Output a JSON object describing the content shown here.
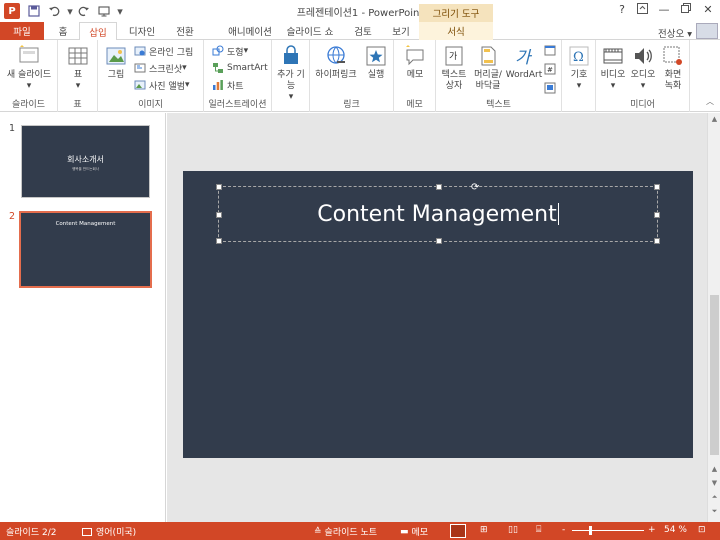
{
  "app": {
    "title": "프레젠테이션1 - PowerPoint",
    "context_tool": "그리기 도구",
    "user": "전상오",
    "logo": "P"
  },
  "icons": {
    "save": "floppy-icon",
    "undo": "undo-icon",
    "redo": "redo-icon",
    "start": "slideshow-icon",
    "help": "?",
    "minimize": "—",
    "restore": "▫",
    "close": "✕"
  },
  "tabs": {
    "file": "파일",
    "home": "홈",
    "insert": "삽입",
    "design": "디자인",
    "transitions": "전환",
    "animations": "애니메이션",
    "slideshow": "슬라이드 쇼",
    "review": "검토",
    "view": "보기",
    "format": "서식"
  },
  "ribbon": {
    "new_slide": "새 슬라이드",
    "table": "표",
    "picture": "그림",
    "online_picture": "온라인 그림",
    "screenshot": "스크린샷",
    "photo_album": "사진 앨범",
    "shapes": "도형",
    "smartart": "SmartArt",
    "chart": "차트",
    "apps": "추가 기능",
    "hyperlink": "하이퍼링크",
    "action": "실행",
    "comment": "메모",
    "textbox": "텍스트 상자",
    "header_footer": "머리글/ 바닥글",
    "wordart": "WordArt",
    "symbol": "기호",
    "video": "비디오",
    "audio": "오디오",
    "screen_recording": "화면 녹화",
    "groups": {
      "slides": "슬라이드",
      "tables": "표",
      "images": "이미지",
      "illustrations": "일러스트레이션",
      "apps": "",
      "links": "링크",
      "comments": "메모",
      "text": "텍스트",
      "symbols": "",
      "media": "미디어"
    }
  },
  "thumbnails": [
    {
      "number": "1",
      "title": "회사소개서",
      "subtitle": "행복을 만드는회사"
    },
    {
      "number": "2",
      "title": "Content Management",
      "subtitle": ""
    }
  ],
  "slide": {
    "title": "Content Management"
  },
  "status": {
    "slide_counter": "슬라이드 2/2",
    "language": "영어(미국)",
    "notes": "슬라이드 노트",
    "comments": "메모",
    "zoom_minus": "-",
    "zoom_plus": "+",
    "zoom": "54 %",
    "zoom_level": 0.54
  },
  "colors": {
    "accent": "#d24726",
    "slide_bg": "#323c4c",
    "context_tab": "#f5e3bd"
  }
}
